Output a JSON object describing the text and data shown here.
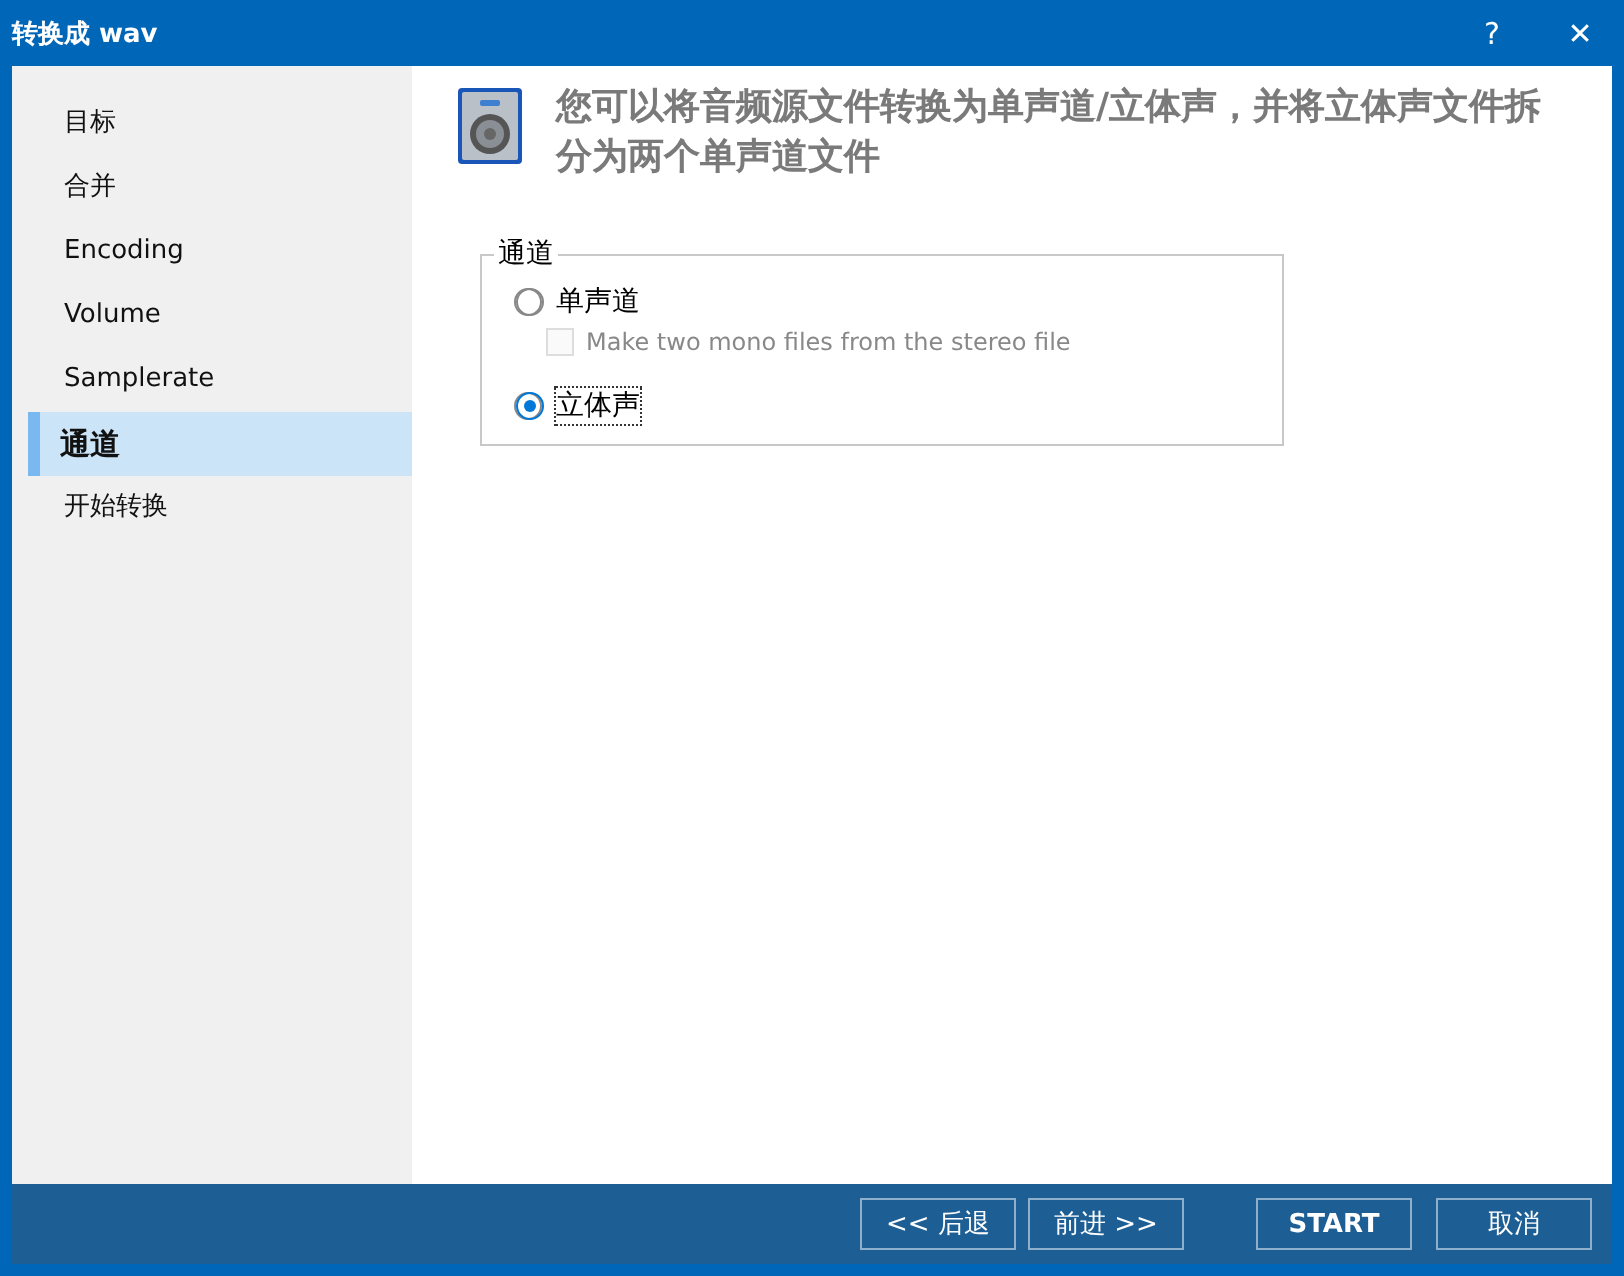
{
  "window": {
    "title": "转换成 wav",
    "help": "?",
    "close": "✕"
  },
  "sidebar": {
    "items": [
      {
        "label": "目标",
        "selected": false
      },
      {
        "label": "合并",
        "selected": false
      },
      {
        "label": "Encoding",
        "selected": false
      },
      {
        "label": "Volume",
        "selected": false
      },
      {
        "label": "Samplerate",
        "selected": false
      },
      {
        "label": "通道",
        "selected": true
      },
      {
        "label": "开始转换",
        "selected": false
      }
    ]
  },
  "header": {
    "text": "您可以将音频源文件转换为单声道/立体声，并将立体声文件拆分为两个单声道文件"
  },
  "group": {
    "title": "通道",
    "options": [
      {
        "kind": "radio",
        "label": "单声道",
        "selected": false
      },
      {
        "kind": "checkbox",
        "label": "Make two mono files from the stereo file",
        "checked": false,
        "disabled": true
      },
      {
        "kind": "radio",
        "label": "立体声",
        "selected": true
      }
    ]
  },
  "buttons": [
    {
      "label": "<< 后退",
      "kind": "nav"
    },
    {
      "label": "前进 >>",
      "kind": "nav"
    },
    {
      "label": "START",
      "kind": "primary"
    },
    {
      "label": "取消",
      "kind": "nav"
    }
  ]
}
